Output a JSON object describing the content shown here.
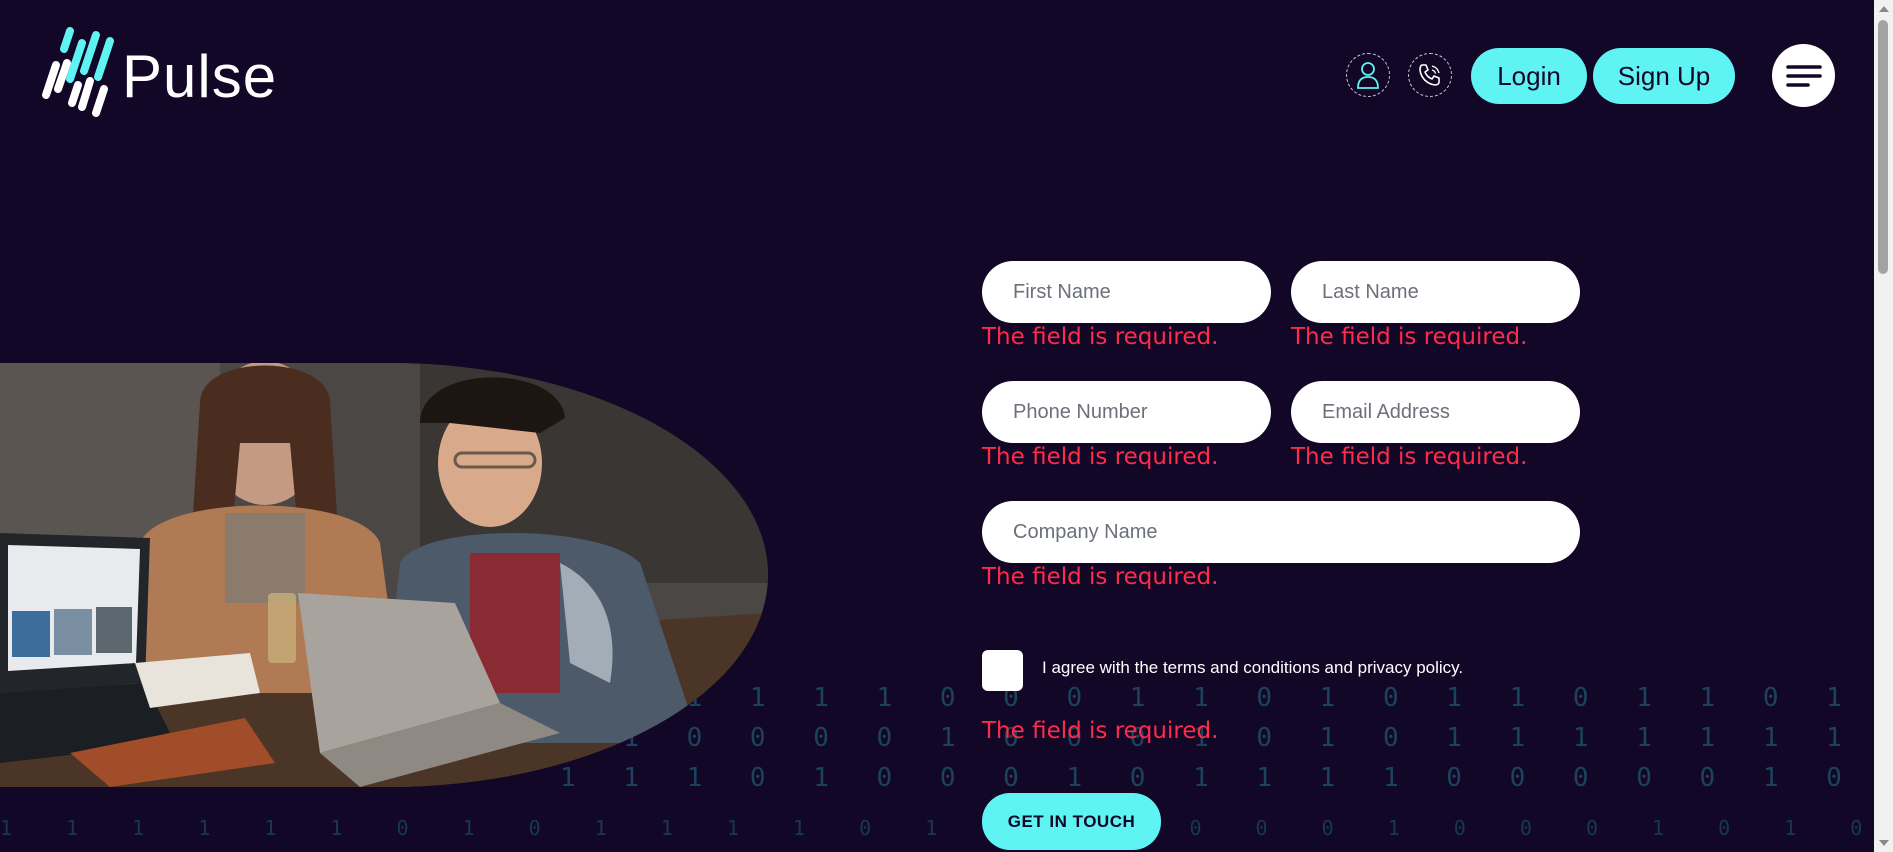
{
  "brand": {
    "name": "Pulse",
    "accent": "#5ff3f4",
    "background": "#130727",
    "error_color": "#ff2b4b"
  },
  "header": {
    "user_icon": "user-icon",
    "phone_icon": "phone-icon",
    "login_label": "Login",
    "signup_label": "Sign Up",
    "menu_icon": "hamburger-menu-icon"
  },
  "hero": {
    "image": "two-women-laughing-at-laptops-photo"
  },
  "form": {
    "first_name": {
      "placeholder": "First Name",
      "value": "",
      "error": "The field is required."
    },
    "last_name": {
      "placeholder": "Last Name",
      "value": "",
      "error": "The field is required."
    },
    "phone": {
      "placeholder": "Phone Number",
      "value": "",
      "error": "The field is required."
    },
    "email": {
      "placeholder": "Email Address",
      "value": "",
      "error": "The field is required."
    },
    "company": {
      "placeholder": "Company Name",
      "value": "",
      "error": "The field is required."
    },
    "agree": {
      "label": "I agree with the terms and conditions and privacy policy.",
      "checked": false,
      "error": "The field is required."
    },
    "submit_label": "GET IN TOUCH"
  }
}
